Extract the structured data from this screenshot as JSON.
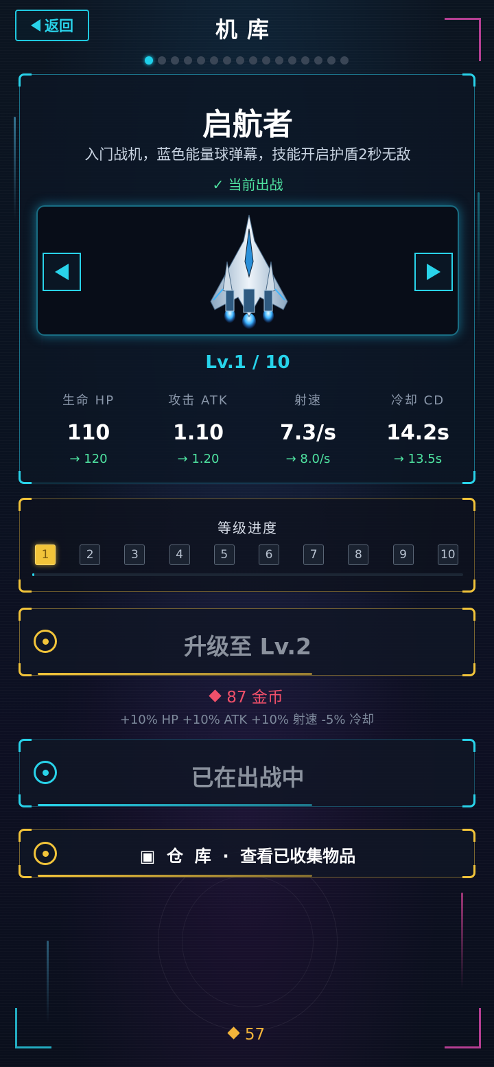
{
  "header": {
    "back_label": "返回",
    "title": "机库",
    "pager_count": 16,
    "pager_active": 0
  },
  "ship": {
    "name": "启航者",
    "description": "入门战机，蓝色能量球弹幕，技能开启护盾2秒无敌",
    "status": "✓ 当前出战",
    "level_text": "Lv.1 / 10",
    "image_icon": "jet-fighter-icon",
    "stats": [
      {
        "label": "生命 HP",
        "value": "110",
        "next": "→ 120"
      },
      {
        "label": "攻击 ATK",
        "value": "1.10",
        "next": "→ 1.20"
      },
      {
        "label": "射速",
        "value": "7.3/s",
        "next": "→ 8.0/s"
      },
      {
        "label": "冷却 CD",
        "value": "14.2s",
        "next": "→ 13.5s"
      }
    ]
  },
  "progress": {
    "title": "等级进度",
    "levels": [
      "1",
      "2",
      "3",
      "4",
      "5",
      "6",
      "7",
      "8",
      "9",
      "10"
    ],
    "current": 1
  },
  "upgrade": {
    "label": "升级至 Lv.2",
    "cost": "87 金币",
    "bonus": "+10% HP  +10% ATK  +10% 射速  -5% 冷却"
  },
  "deploy": {
    "label": "已在出战中"
  },
  "warehouse": {
    "label": "▣  仓  库  ·  查看已收集物品"
  },
  "footer": {
    "coins": "57"
  },
  "colors": {
    "accent": "#29d3ea",
    "gold": "#f2c43a",
    "green": "#4fe3a1",
    "red": "#f0506a"
  }
}
